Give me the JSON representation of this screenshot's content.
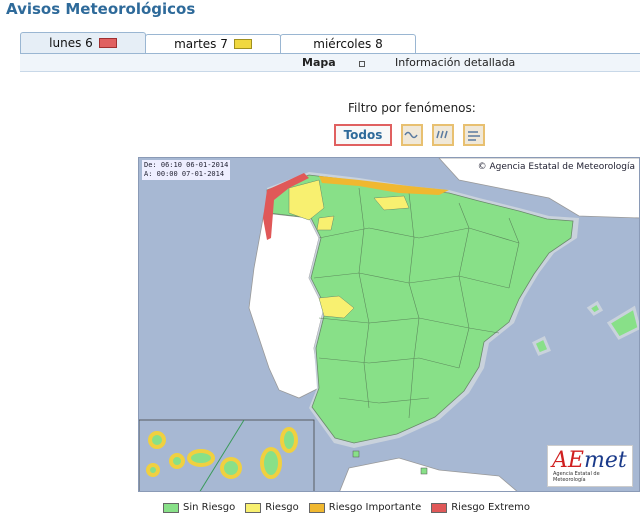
{
  "page": {
    "title": "Avisos Meteorológicos"
  },
  "tabs": [
    {
      "label": "lunes 6",
      "swatch": "#e06060",
      "active": true
    },
    {
      "label": "martes 7",
      "swatch": "#f0d840",
      "active": false
    },
    {
      "label": "miércoles 8",
      "swatch": "",
      "active": false
    }
  ],
  "subnav": {
    "map_label": "Mapa",
    "info_label": "Información detallada"
  },
  "filter": {
    "label": "Filtro por fenómenos:",
    "all_label": "Todos",
    "icons": [
      "coast-waves-icon",
      "rain-icon",
      "wind-icon"
    ]
  },
  "map": {
    "valid_from": "De: 06:10 06-01-2014",
    "valid_to": "A:  00:00 07-01-2014",
    "copyright": "© Agencia Estatal de Meteorología",
    "logo": {
      "text_a": "AE",
      "text_b": "met",
      "subtitle": "Agencia Estatal de Meteorología"
    }
  },
  "legend": [
    {
      "label": "Sin Riesgo",
      "color": "#88e088"
    },
    {
      "label": "Riesgo",
      "color": "#f8f070"
    },
    {
      "label": "Riesgo Importante",
      "color": "#f0b830"
    },
    {
      "label": "Riesgo Extremo",
      "color": "#e05858"
    }
  ],
  "colors": {
    "accent": "#2e6a9a",
    "sea": "#a7b8d3",
    "land_other": "#ffffff",
    "no_risk": "#88e088"
  }
}
